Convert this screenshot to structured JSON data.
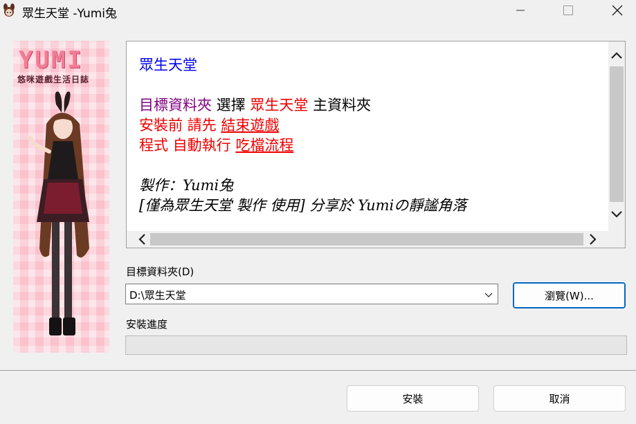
{
  "window": {
    "title": "眾生天堂 -Yumi兔"
  },
  "banner": {
    "logo_text": "YUMI",
    "subtitle": "悠咪遊戲生活日誌"
  },
  "readme": {
    "line1": "眾生天堂",
    "line2_a": "目標資料夾",
    "line2_b": " 選擇 ",
    "line2_c": "眾生天堂",
    "line2_d": " 主資料夾",
    "line3_a": "安裝前 請先 ",
    "line3_b": "結束遊戲",
    "line4_a": "程式 自動執行 ",
    "line4_b": "吃檔流程",
    "line5": "製作：Yumi兔",
    "line6": "[僅為眾生天堂 製作 使用] 分享於 Yumiの靜謐角落"
  },
  "destination": {
    "label": "目標資料夾(D)",
    "value": "D:\\眾生天堂",
    "browse_label": "瀏覽(W)..."
  },
  "progress": {
    "label": "安裝進度",
    "value": 0
  },
  "footer": {
    "install_label": "安裝",
    "cancel_label": "取消"
  },
  "colors": {
    "accent": "#0067c0",
    "link_blue": "#0000ee",
    "emphasis_red": "#ee0000",
    "purple": "#800080"
  }
}
